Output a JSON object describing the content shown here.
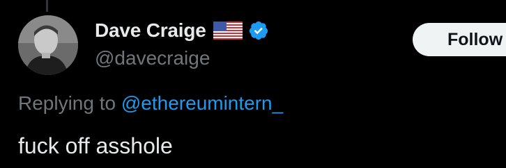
{
  "author": {
    "display_name": "Dave Craige",
    "handle": "@davecraige",
    "flag_icon": "us-flag-icon",
    "verified_icon": "verified-badge-icon",
    "verified_color": "#1d9bf0"
  },
  "follow_button": {
    "label": "Follow"
  },
  "reply": {
    "prefix": "Replying to",
    "target": "@ethereumintern_"
  },
  "tweet": {
    "text": "fuck off asshole"
  },
  "colors": {
    "background": "#000000",
    "primary_text": "#e7e9ea",
    "secondary_text": "#71767b",
    "link": "#1d9bf0",
    "button_bg": "#eff3f4"
  }
}
